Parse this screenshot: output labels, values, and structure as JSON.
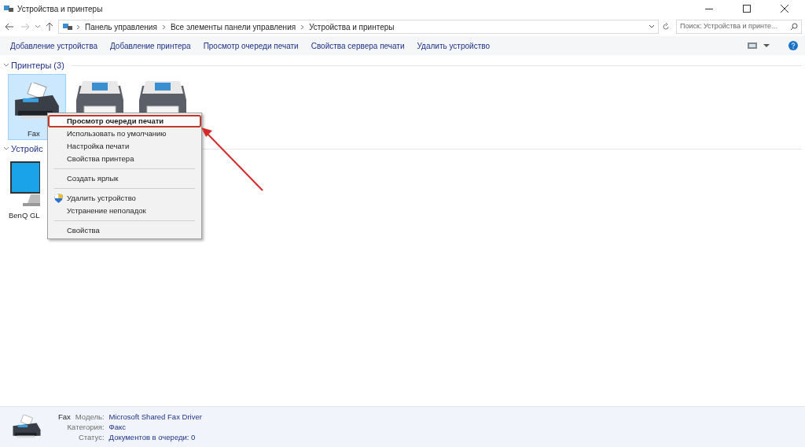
{
  "window": {
    "title": "Устройства и принтеры"
  },
  "address": {
    "crumbs": [
      "Панель управления",
      "Все элементы панели управления",
      "Устройства и принтеры"
    ],
    "search_placeholder": "Поиск: Устройства и принте..."
  },
  "toolbar": [
    "Добавление устройства",
    "Добавление принтера",
    "Просмотр очереди печати",
    "Свойства сервера печати",
    "Удалить устройство"
  ],
  "groups": [
    {
      "title": "Принтеры (3)",
      "expanded": true,
      "items": [
        {
          "kind": "fax",
          "label": "Fax",
          "selected": true
        },
        {
          "kind": "printer",
          "selected": false
        },
        {
          "kind": "printer",
          "selected": false
        }
      ]
    },
    {
      "title": "Устройс",
      "expanded": true,
      "items": [
        {
          "kind": "monitor",
          "label": "BenQ GL",
          "selected": false
        }
      ]
    }
  ],
  "context_menu": [
    {
      "kind": "item",
      "label": "Просмотр очереди печати",
      "selected": true
    },
    {
      "kind": "item",
      "label": "Использовать по умолчанию",
      "selected": false
    },
    {
      "kind": "item",
      "label": "Настройка печати",
      "selected": false
    },
    {
      "kind": "item",
      "label": "Свойства принтера",
      "selected": false
    },
    {
      "kind": "separator"
    },
    {
      "kind": "item",
      "label": "Создать ярлык",
      "selected": false
    },
    {
      "kind": "separator"
    },
    {
      "kind": "shield",
      "label": "Удалить устройство",
      "selected": false
    },
    {
      "kind": "item",
      "label": "Устранение неполадок",
      "selected": false
    },
    {
      "kind": "separator"
    },
    {
      "kind": "item",
      "label": "Свойства",
      "selected": false
    }
  ],
  "details": {
    "name": "Fax",
    "fields": [
      {
        "label": "Модель:",
        "value": "Microsoft Shared Fax Driver"
      },
      {
        "label": "Категория:",
        "value": "Факс"
      },
      {
        "label": "Статус:",
        "value": "Документов в очереди: 0"
      }
    ]
  }
}
